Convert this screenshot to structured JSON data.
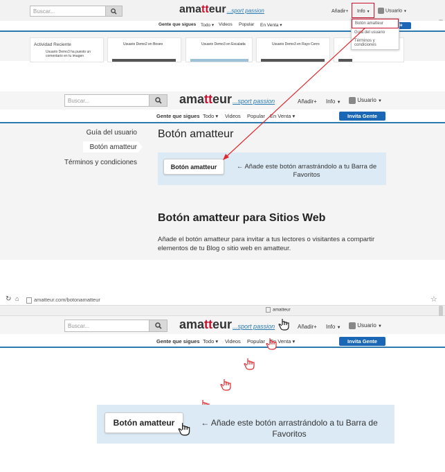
{
  "brand": {
    "name_pre": "ama",
    "name_t": "tt",
    "name_post": "eur",
    "tagline": "...sport passion"
  },
  "header": {
    "search_placeholder": "Buscar...",
    "add": "Añadir+",
    "info": "Info",
    "user": "Usuario"
  },
  "subnav": {
    "following": "Gente que sigues",
    "all": "Todo",
    "videos": "Videos",
    "popular": "Popular",
    "for_sale": "En Venta",
    "invite": "Invita Gente"
  },
  "panel1": {
    "recent_title": "Actividad Reciente",
    "recent_text": "Usuario Demo3 ha puesto un comentario en tu imagen",
    "cards": [
      {
        "user": "Usuario Demo2",
        "place": "en Boseo"
      },
      {
        "user": "Usuario Demo3",
        "place": "en Escalada"
      },
      {
        "user": "Usuario Demo3",
        "place": "en Rayo Cerro"
      },
      {
        "user": "Usuario Demo3",
        "place": "en ..."
      }
    ],
    "info_menu": [
      "Botón amatteur",
      "Guía del usuario",
      "Términos y condiciones"
    ]
  },
  "panel2": {
    "side_links": [
      "Guía del usuario",
      "Botón amatteur",
      "Términos y condiciones"
    ],
    "page_title": "Botón amatteur",
    "button_label": "Botón amatteur",
    "hint": "← Añade este botón arrastrándolo a tu Barra de Favoritos",
    "section_title": "Botón amatteur para Sitios Web",
    "section_text": "Añade el botón amatteur para invitar a tus lectores o visitantes a compartir elementos de tu Blog o sitio web en amatteur."
  },
  "panel3": {
    "url": "amatteur.com/botonamatteur",
    "bookmark": "amatteur",
    "button_label": "Botón amatteur",
    "hint": "← Añade este botón arrastrándolo a tu Barra de Favoritos"
  },
  "colors": {
    "accent": "#1a67b5",
    "red": "#c8102e",
    "panel": "#dbeaf5"
  }
}
